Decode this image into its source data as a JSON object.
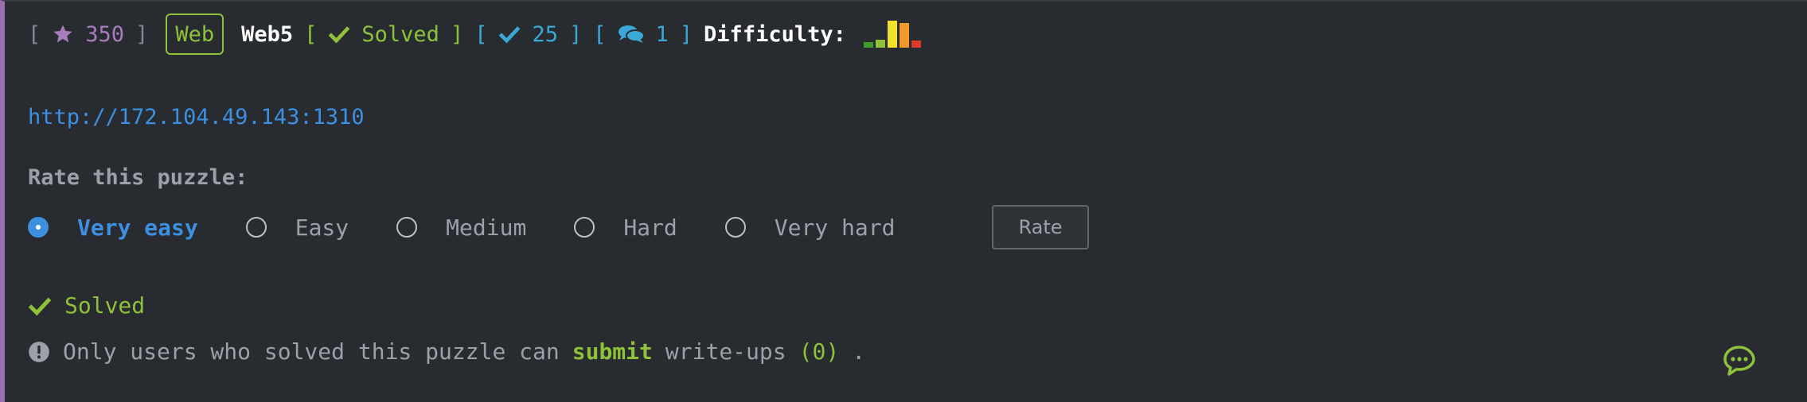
{
  "header": {
    "bracket_open": "[",
    "bracket_close": "]",
    "points": "350",
    "category": "Web",
    "title": "Web5",
    "status": "Solved",
    "solves": "25",
    "comments": "1",
    "difficulty_label": "Difficulty:",
    "difficulty_bars": [
      {
        "level": 0.2,
        "color": "#3f9b2a"
      },
      {
        "level": 0.3,
        "color": "#8fc23a"
      },
      {
        "level": 1.0,
        "color": "#f2e12b"
      },
      {
        "level": 0.9,
        "color": "#f19a2b"
      },
      {
        "level": 0.25,
        "color": "#e03a2b"
      }
    ]
  },
  "link": "http://172.104.49.143:1310",
  "rating": {
    "heading": "Rate this puzzle:",
    "options": [
      "Very easy",
      "Easy",
      "Medium",
      "Hard",
      "Very hard"
    ],
    "selected": "Very easy",
    "button": "Rate"
  },
  "solved_text": "Solved",
  "writeups": {
    "prefix": "Only users who solved this puzzle can",
    "link": "submit",
    "suffix": "write-ups",
    "count": "(0)",
    "end": "."
  },
  "colors": {
    "accent": "#8fc23a",
    "link": "#3d8fe0",
    "info": "#3ba9d8",
    "points": "#a87cbd"
  }
}
